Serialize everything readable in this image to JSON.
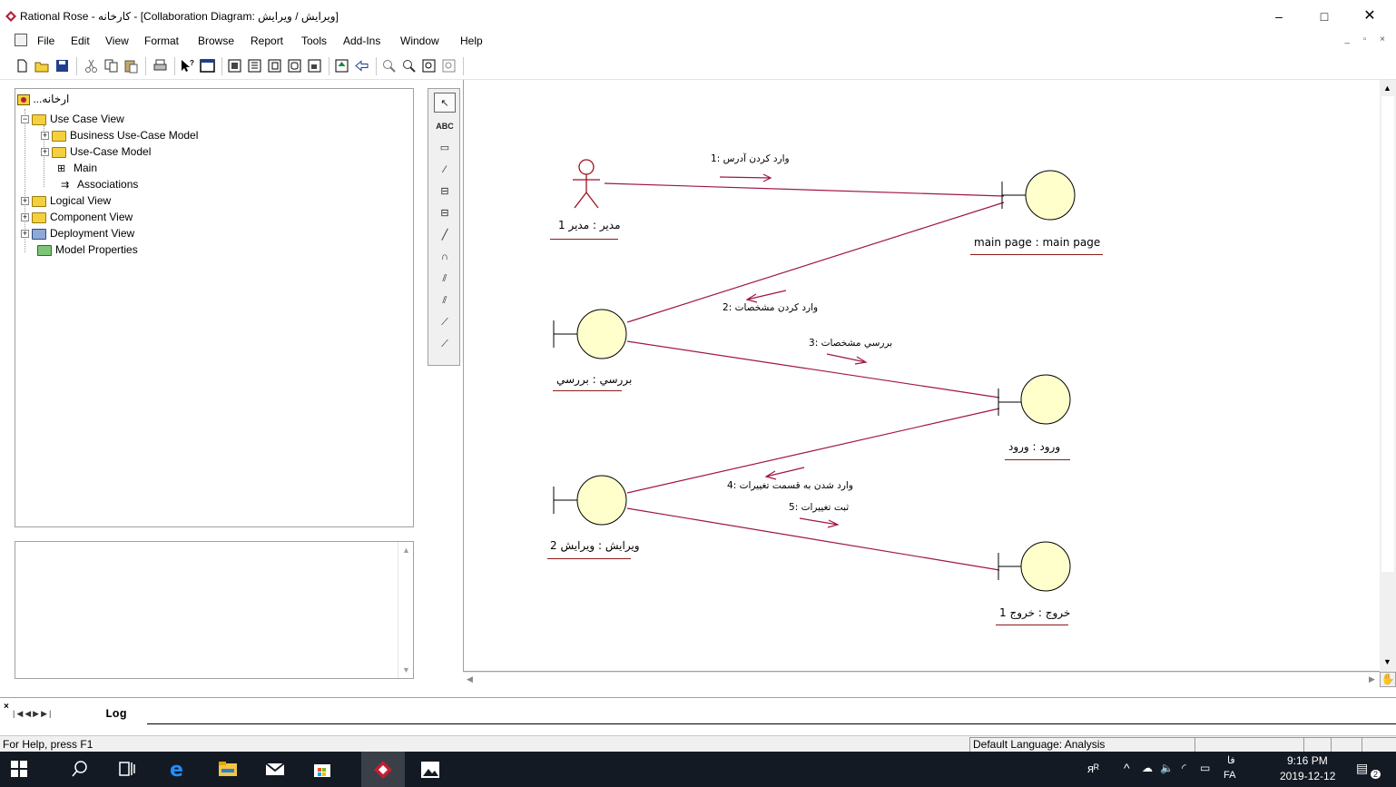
{
  "window": {
    "title": "Rational Rose - کارخانه - [Collaboration Diagram: ویرایش / ویرایش]",
    "controls": [
      "–",
      "□",
      "✕"
    ]
  },
  "menu": {
    "items": [
      "File",
      "Edit",
      "View",
      "Format",
      "Browse",
      "Report",
      "Tools",
      "Add-Ins",
      "Window",
      "Help"
    ],
    "mdi_controls": "_ ▫ ×"
  },
  "browser": {
    "root": "...ارخانه",
    "items": [
      {
        "label": "Use Case View"
      },
      {
        "label": "Business Use-Case Model"
      },
      {
        "label": "Use-Case Model"
      },
      {
        "label": "Main"
      },
      {
        "label": "Associations"
      },
      {
        "label": "Logical View"
      },
      {
        "label": "Component View"
      },
      {
        "label": "Deployment View"
      },
      {
        "label": "Model Properties"
      }
    ]
  },
  "palette": {
    "tools": [
      "select-arrow",
      "text-abc",
      "note",
      "anchor-note",
      "object",
      "class-instance",
      "object-link",
      "link-to-self",
      "link-message",
      "reverse-link-message",
      "data-token",
      "reverse-data-token"
    ],
    "abc_label": "ABC"
  },
  "diagram": {
    "objects": [
      {
        "name": "مدیر : مدیر  1",
        "kind": "actor"
      },
      {
        "name": "main page : main  page",
        "kind": "boundary"
      },
      {
        "name": "بررسي : بررسي",
        "kind": "boundary"
      },
      {
        "name": "ورود : ورود",
        "kind": "boundary"
      },
      {
        "name": "ویرایش : ویرایش  2",
        "kind": "boundary"
      },
      {
        "name": "خروج : خروج 1",
        "kind": "boundary"
      }
    ],
    "messages": [
      {
        "text": "وارد کردن آدرس :1"
      },
      {
        "text": "وارد کردن مشخصات :2"
      },
      {
        "text": "بررسي مشخصات :3"
      },
      {
        "text": "وارد شدن به قسمت تغییرات :4"
      },
      {
        "text": "ثبت تغییرات :5"
      }
    ],
    "colors": {
      "link": "#a0154a",
      "object_fill": "#ffffcc",
      "actor": "#a01020"
    }
  },
  "log": {
    "tab": "Log"
  },
  "status": {
    "help": "For Help, press F1",
    "language": "Default Language: Analysis"
  },
  "taskbar": {
    "lang_top": "فا",
    "lang": "FA",
    "time": "9:16 PM",
    "date": "2019-12-12",
    "notification_count": "2"
  }
}
